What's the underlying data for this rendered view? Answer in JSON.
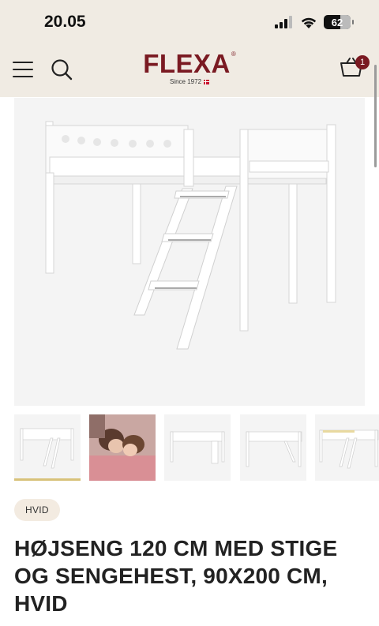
{
  "status_bar": {
    "time": "20.05",
    "battery": "62"
  },
  "header": {
    "logo_text": "FLEXA",
    "logo_registered": "®",
    "logo_since": "Since 1972",
    "cart_count": "1",
    "icons": {
      "menu": "hamburger-menu-icon",
      "search": "search-icon",
      "cart": "basket-icon"
    }
  },
  "gallery": {
    "main_image": "white loft bed with slanted ladder and bed rail",
    "thumbnails": [
      {
        "name": "bed-with-ladder",
        "active": true
      },
      {
        "name": "mother-and-child-lifestyle-photo",
        "active": false
      },
      {
        "name": "bed-front-view",
        "active": false
      },
      {
        "name": "bed-side-ladder-view",
        "active": false
      },
      {
        "name": "bed-angled-view",
        "active": false
      }
    ]
  },
  "product": {
    "color_chip": "HVID",
    "title": "HØJSENG 120 CM MED STIGE OG SENGEHEST, 90X200 CM, HVID"
  },
  "colors": {
    "header_bg": "#f0ebe3",
    "brand": "#7a1a22",
    "chip_bg": "#f3ebe1",
    "active_thumb_underline": "#d8c27a"
  }
}
